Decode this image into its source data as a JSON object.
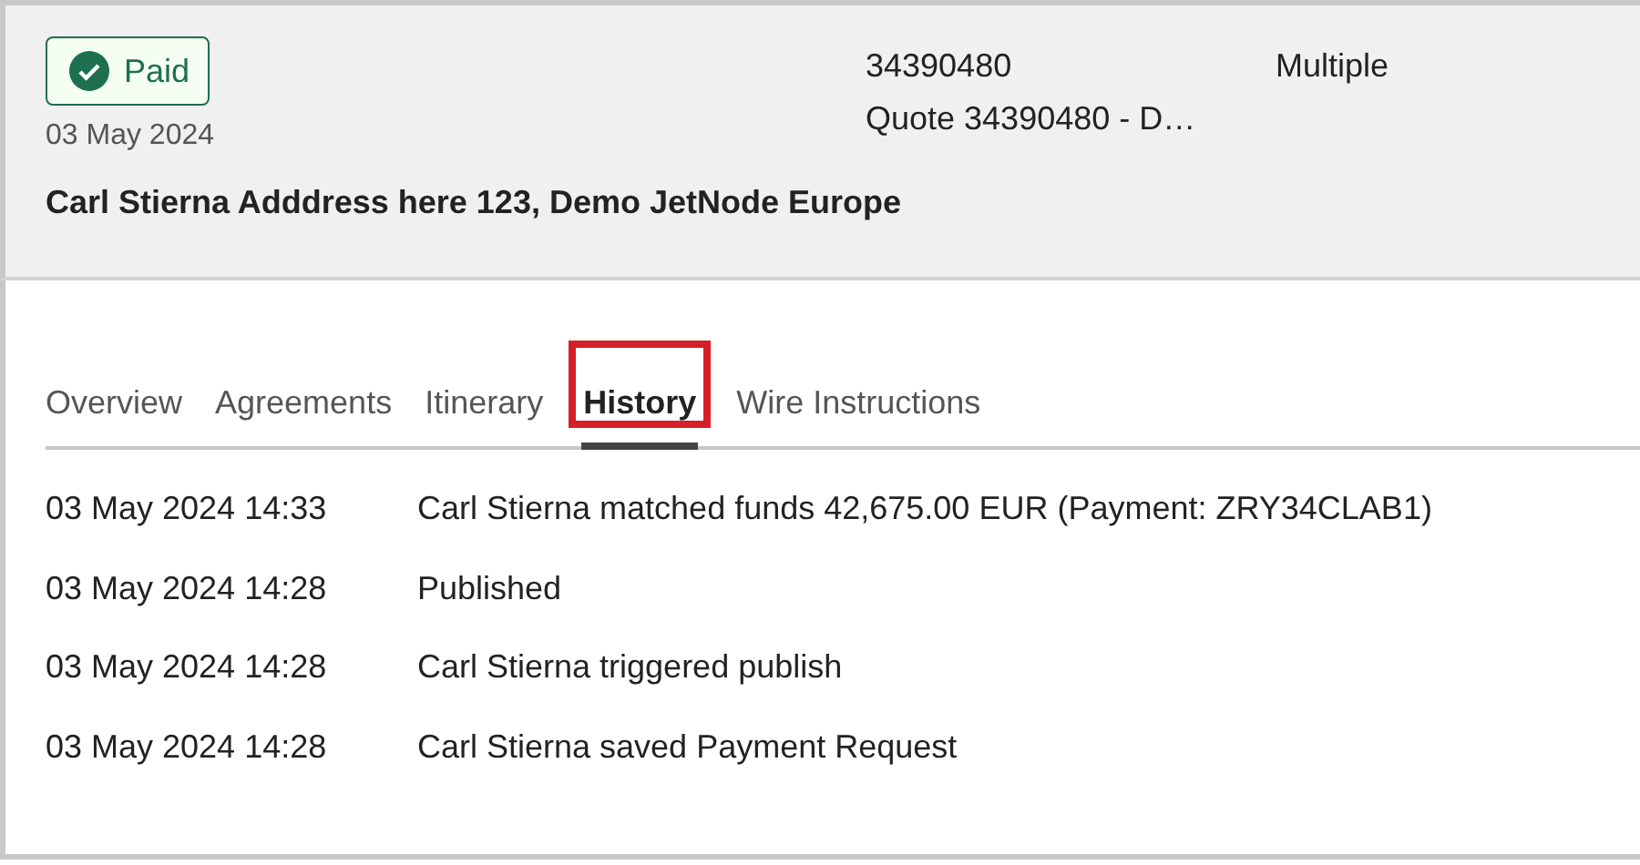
{
  "header": {
    "status": {
      "label": "Paid",
      "kind": "success"
    },
    "date": "03 May 2024",
    "reference": "34390480",
    "quote": "Quote 34390480 - D…",
    "type": "Multiple",
    "address": "Carl Stierna Adddress here 123, Demo JetNode Europe"
  },
  "tabs": [
    {
      "label": "Overview",
      "selected": false,
      "highlighted": false
    },
    {
      "label": "Agreements",
      "selected": false,
      "highlighted": false
    },
    {
      "label": "Itinerary",
      "selected": false,
      "highlighted": false
    },
    {
      "label": "History",
      "selected": true,
      "highlighted": true
    },
    {
      "label": "Wire Instructions",
      "selected": false,
      "highlighted": false
    }
  ],
  "history": [
    {
      "time": "03 May 2024 14:33",
      "event": "Carl Stierna matched funds 42,675.00 EUR (Payment: ZRY34CLAB1)"
    },
    {
      "time": "03 May 2024 14:28",
      "event": "Published"
    },
    {
      "time": "03 May 2024 14:28",
      "event": "Carl Stierna triggered publish"
    },
    {
      "time": "03 May 2024 14:28",
      "event": "Carl Stierna saved Payment Request"
    }
  ]
}
